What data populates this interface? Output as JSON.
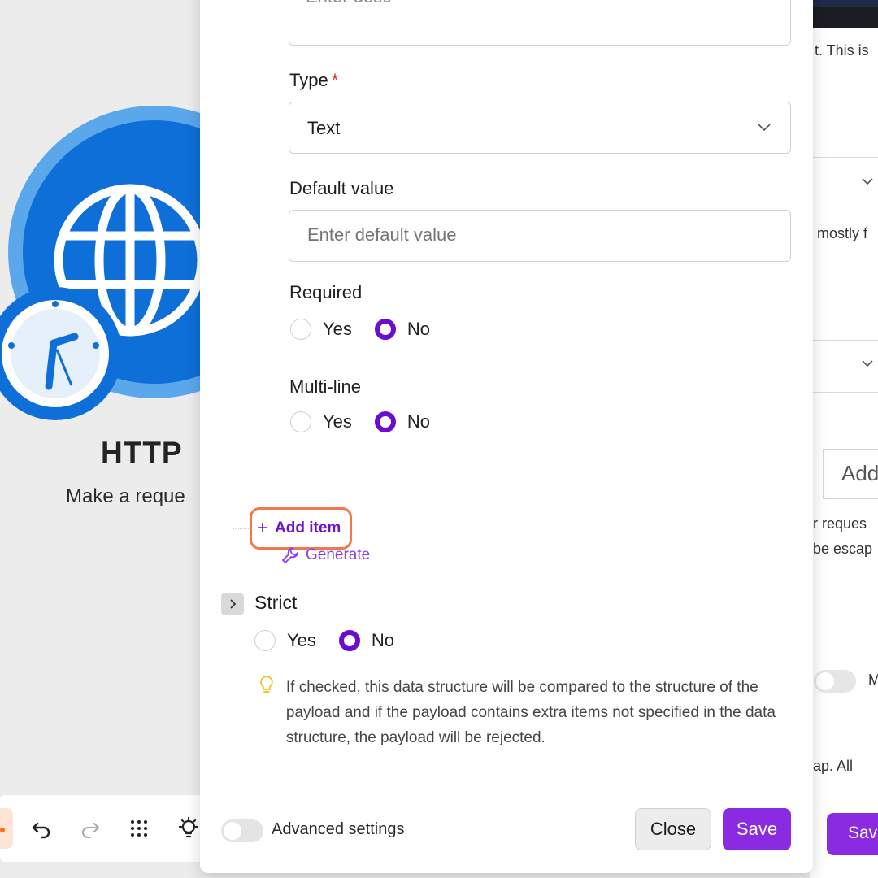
{
  "background": {
    "module": {
      "title": "HTTP",
      "subtitle": "Make a reque"
    },
    "toolbar": {
      "icons": [
        "undo-icon",
        "redo-icon",
        "grid-dots-icon",
        "bulb-icon"
      ]
    },
    "right_panel": {
      "text_1": "t. This is",
      "text_2": "mostly f",
      "add_label": "Add",
      "text_3": "r reques",
      "text_4": "be escap",
      "toggle_label": "M",
      "text_5": "ap. All",
      "save_label": "Save"
    }
  },
  "form": {
    "description": {
      "placeholder": "Enter desc"
    },
    "type": {
      "label": "Type",
      "required_marker": "*",
      "value": "Text"
    },
    "default_value": {
      "label": "Default value",
      "placeholder": "Enter default value"
    },
    "required": {
      "label": "Required",
      "options": [
        "Yes",
        "No"
      ],
      "selected": "No"
    },
    "multi_line": {
      "label": "Multi-line",
      "options": [
        "Yes",
        "No"
      ],
      "selected": "No"
    },
    "add_item": {
      "plus": "+",
      "label": "Add item"
    },
    "generate": {
      "label": "Generate"
    },
    "strict": {
      "label": "Strict",
      "options": [
        "Yes",
        "No"
      ],
      "selected": "No",
      "hint": "If checked, this data structure will be compared to the structure of the payload and if the payload contains extra items not specified in the data structure, the payload will be rejected."
    }
  },
  "footer": {
    "advanced_settings_label": "Advanced settings",
    "close_label": "Close",
    "save_label": "Save"
  },
  "colors": {
    "accent": "#8a2be2",
    "radio_checked": "#6a0dcf",
    "highlight": "#f0784a",
    "required_star": "#e5252a",
    "module_blue": "#1a78e0"
  }
}
